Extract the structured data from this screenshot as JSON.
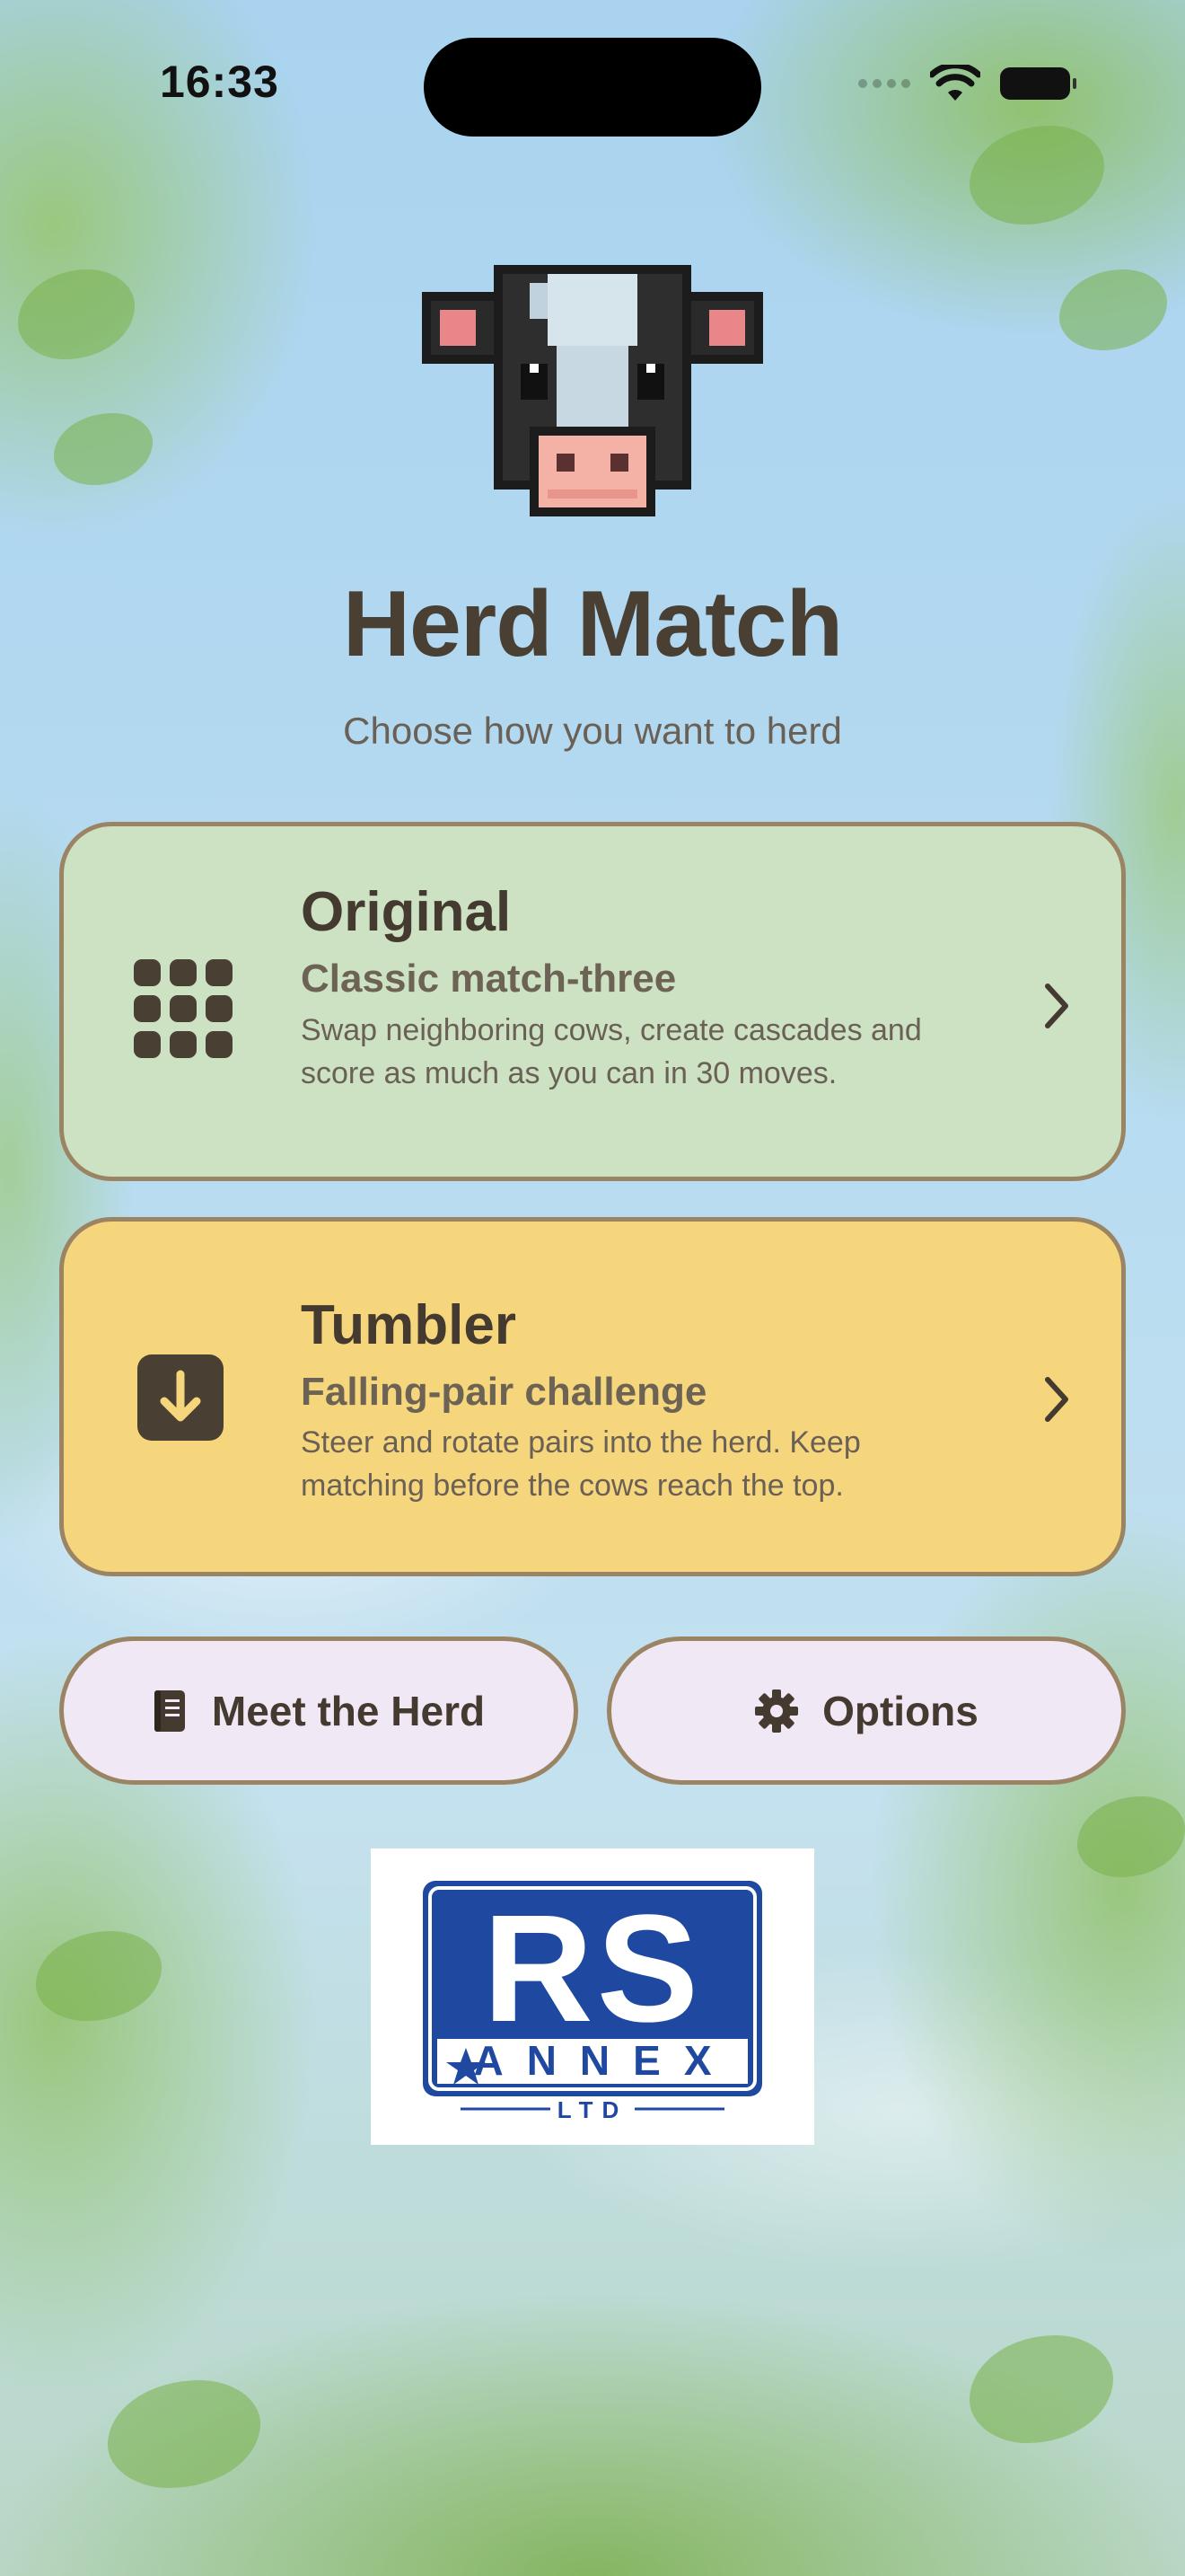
{
  "status_bar": {
    "time": "16:33"
  },
  "header": {
    "title": "Herd Match",
    "subtitle": "Choose how you want to herd"
  },
  "modes": [
    {
      "title": "Original",
      "subtitle": "Classic match-three",
      "description": "Swap neighboring cows, create cascades and score as much as you can in 30 moves.",
      "icon": "grid-icon",
      "color": "#cce2c3"
    },
    {
      "title": "Tumbler",
      "subtitle": "Falling-pair challenge",
      "description": "Steer and rotate pairs into the herd. Keep matching before the cows reach the top.",
      "icon": "arrow-down-box-icon",
      "color": "#f5d67c"
    }
  ],
  "buttons": {
    "meet_herd": {
      "label": "Meet the Herd",
      "icon": "book-icon"
    },
    "options": {
      "label": "Options",
      "icon": "gear-icon"
    }
  },
  "sponsor": {
    "logo_text_main": "RS",
    "logo_text_annex": "ANNEX",
    "logo_text_ltd": "LTD",
    "brand_color": "#1f49a0"
  },
  "colors": {
    "text_dark": "#4a3f33",
    "card_border": "#9b8463",
    "pill_bg": "#f0e8f4"
  }
}
